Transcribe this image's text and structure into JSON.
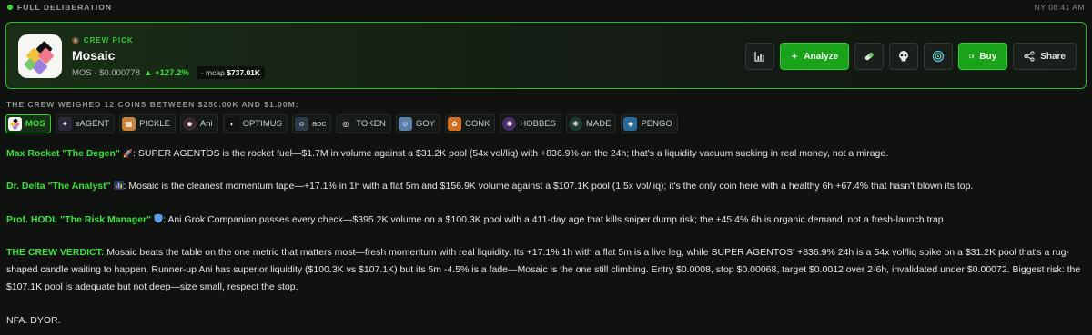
{
  "topbar": {
    "mode": "FULL DELIBERATION",
    "time": "NY 08:41 AM"
  },
  "pick": {
    "crew_label": "CREW PICK",
    "name": "Mosaic",
    "ticker_price": "MOS · $0.000778",
    "change": "▲ +127.2%",
    "mcap_prefix": "· mcap",
    "mcap_value": "$737.01K"
  },
  "actions": {
    "analyze": "Analyze",
    "buy": "Buy",
    "share": "Share"
  },
  "weighed": "THE CREW WEIGHED 12 COINS BETWEEN $250.00K AND $1.00M:",
  "chips": [
    {
      "label": "MOS"
    },
    {
      "label": "sAGENT"
    },
    {
      "label": "PICKLE"
    },
    {
      "label": "Ani"
    },
    {
      "label": "OPTIMUS"
    },
    {
      "label": "aoc"
    },
    {
      "label": "TOKEN"
    },
    {
      "label": "GOY"
    },
    {
      "label": "CONK"
    },
    {
      "label": "HOBBES"
    },
    {
      "label": "MADE"
    },
    {
      "label": "PENGO"
    }
  ],
  "messages": {
    "degen": {
      "speaker": "Max Rocket \"The Degen\"",
      "text": ": SUPER AGENTOS is the rocket fuel—$1.7M in volume against a $31.2K pool (54x vol/liq) with +836.9% on the 24h; that's a liquidity vacuum sucking in real money, not a mirage."
    },
    "analyst": {
      "speaker": "Dr. Delta \"The Analyst\"",
      "text": ": Mosaic is the cleanest momentum tape—+17.1% in 1h with a flat 5m and $156.9K volume against a $107.1K pool (1.5x vol/liq); it's the only coin here with a healthy 6h +67.4% that hasn't blown its top."
    },
    "risk": {
      "speaker": "Prof. HODL \"The Risk Manager\"",
      "text": ": Ani Grok Companion passes every check—$395.2K volume on a $100.3K pool with a 411-day age that kills sniper dump risk; the +45.4% 6h is organic demand, not a fresh-launch trap."
    },
    "verdict": {
      "speaker": "THE CREW VERDICT:",
      "text": " Mosaic beats the table on the one metric that matters most—fresh momentum with real liquidity. Its +17.1% 1h with a flat 5m is a live leg, while SUPER AGENTOS' +836.9% 24h is a 54x vol/liq spike on a $31.2K pool that's a rug-shaped candle waiting to happen. Runner-up Ani has superior liquidity ($100.3K vs $107.1K) but its 5m -4.5% is a fade—Mosaic is the one still climbing. Entry $0.0008, stop $0.00068, target $0.0012 over 2-6h, invalidated under $0.00072. Biggest risk: the $107.1K pool is adequate but not deep—size small, respect the stop."
    },
    "disclaimer": "NFA. DYOR."
  },
  "colors": {
    "accent": "#3be03b",
    "background": "#0f120f",
    "card_border": "#2bb82b",
    "button_green": "#1aa21a"
  },
  "icons": [
    "dot-icon",
    "crew-pick-icon",
    "chart-icon",
    "sparkle-icon",
    "pill-icon",
    "skull-icon",
    "swirl-icon",
    "wallet-icon",
    "share-icon",
    "rocket-icon",
    "chart-bars-icon",
    "shield-icon"
  ]
}
